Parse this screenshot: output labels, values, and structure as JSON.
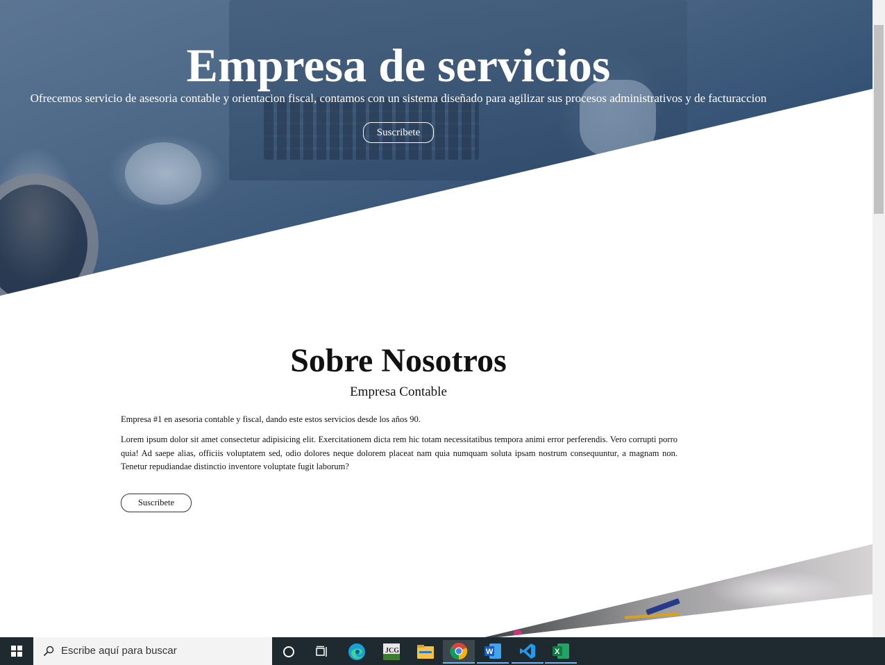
{
  "hero": {
    "title": "Empresa de servicios",
    "subtitle": "Ofrecemos servicio de asesoria contable y orientacion fiscal, contamos con un sistema diseñado para agilizar sus procesos administrativos y de facturaccion",
    "button_label": "Suscribete"
  },
  "about": {
    "title": "Sobre Nosotros",
    "subtitle": "Empresa Contable",
    "paragraph1": "Empresa #1 en asesoria contable y fiscal, dando este estos servicios desde los años 90.",
    "paragraph2": "Lorem ipsum dolor sit amet consectetur adipisicing elit. Exercitationem dicta rem hic totam necessitatibus tempora animi error perferendis. Vero corrupti porro quia! Ad saepe alias, officiis voluptatem sed, odio dolores neque dolorem placeat nam quia numquam soluta ipsam nostrum consequuntur, a magnam non. Tenetur repudiandae distinctio inventore voluptate fugit laborum?",
    "button_label": "Suscribete"
  },
  "taskbar": {
    "search_placeholder": "Escribe aquí para buscar",
    "apps": [
      "cortana-icon",
      "task-view-icon",
      "edge-icon",
      "jcg-app-icon",
      "file-explorer-icon",
      "chrome-icon",
      "word-icon",
      "vscode-icon",
      "excel-icon"
    ]
  },
  "colors": {
    "hero_overlay": "#2f4d70",
    "taskbar": "#1f2a30",
    "accent": "#7fb4e6"
  }
}
